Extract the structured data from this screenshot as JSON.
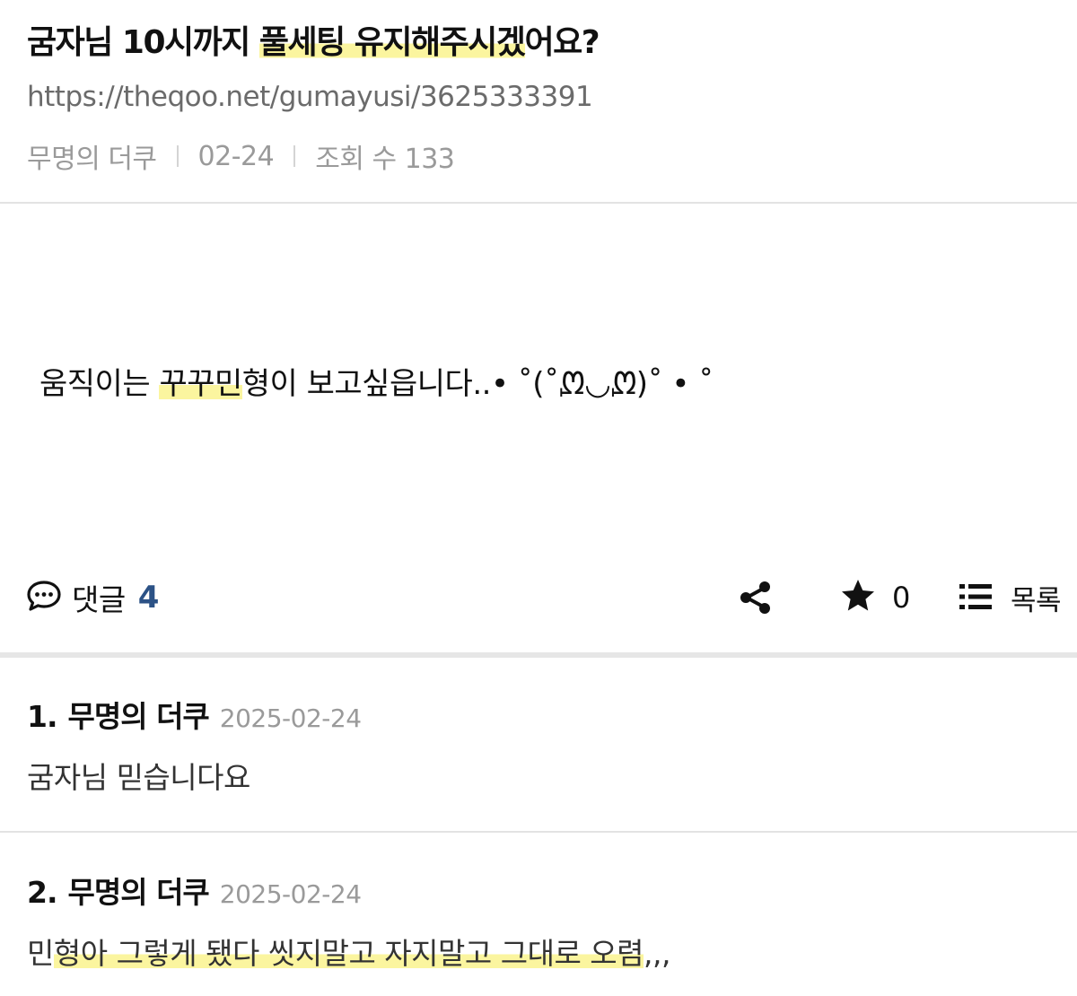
{
  "post": {
    "title_part1": "굼자님 10시까지 ",
    "title_hl": "풀세팅 유지해주시겠",
    "title_part2": "어요?",
    "url": "https://theqoo.net/gumayusi/3625333391",
    "author": "무명의 더쿠",
    "date": "02-24",
    "views": "조회 수 133",
    "body_part1": "움직이는 ",
    "body_hl": "꾸꾸민",
    "body_part2": "형이 보고싶읍니다..• ˚(˚ᘻ◡ᘻ)˚ • ˚"
  },
  "actions": {
    "comment_label": "댓글",
    "comment_count": "4",
    "star_count": "0",
    "list_label": "목록",
    "icons": [
      "speech-bubble-icon",
      "share-icon",
      "star-icon",
      "list-icon"
    ]
  },
  "comments": [
    {
      "index": "1.",
      "author": "무명의 더쿠",
      "date": "2025-02-24",
      "text": "굼자님 믿습니다요"
    },
    {
      "index": "2.",
      "author": "무명의 더쿠",
      "date": "2025-02-24",
      "text_part1": "민",
      "text_hl": "형아 그렇게 됐다 씻지말고 자지말고 그대로 오렴",
      "text_part2": ",,,"
    }
  ],
  "colors": {
    "highlight": "#fbf59f",
    "comment_count": "#2c5286",
    "muted": "#9a9a9a"
  }
}
